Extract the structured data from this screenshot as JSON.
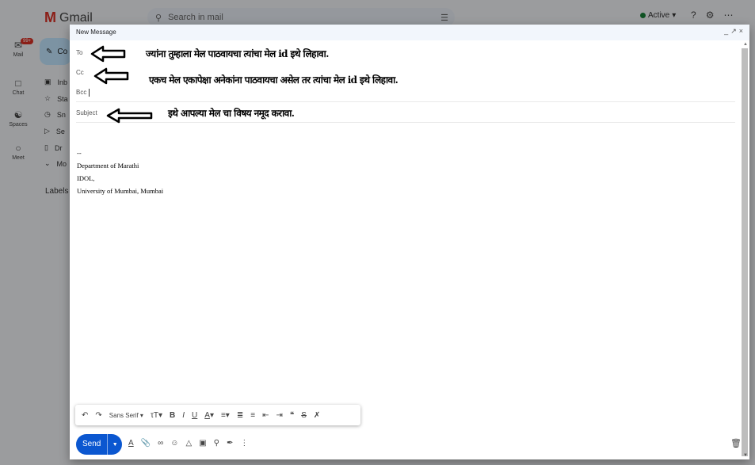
{
  "app": {
    "name": "Gmail"
  },
  "search": {
    "placeholder": "Search in mail"
  },
  "status": {
    "label": "Active"
  },
  "rail": {
    "mail": {
      "label": "Mail",
      "badge": "99+"
    },
    "chat": {
      "label": "Chat"
    },
    "spaces": {
      "label": "Spaces"
    },
    "meet": {
      "label": "Meet"
    }
  },
  "sidebar": {
    "compose_label": "Co",
    "items": [
      {
        "label": "Inb"
      },
      {
        "label": "Sta"
      },
      {
        "label": "Sn"
      },
      {
        "label": "Se"
      },
      {
        "label": "Dr"
      },
      {
        "label": "Mo"
      }
    ],
    "labels_heading": "Labels"
  },
  "compose": {
    "title": "New Message",
    "to_label": "To",
    "cc_label": "Cc",
    "bcc_label": "Bcc",
    "subject_placeholder": "Subject",
    "signature": {
      "dashes": "--",
      "line1": "Department of Marathi",
      "line2": "IDOL,",
      "line3": "University of Mumbai, Mumbai"
    },
    "send_label": "Send",
    "font_label": "Sans Serif"
  },
  "annotations": {
    "to_note": "ज्यांना तुम्हाला मेल पाठवायचा त्यांचा मेल id इथे लिहावा.",
    "cc_note": "एकच मेल एकापेक्षा अनेकांना पाठवायचा असेल तर त्यांचा मेल id इथे लिहावा.",
    "subject_note": "इथे आपल्या मेल चा विषय नमूद करावा."
  },
  "colors": {
    "send": "#0b57d0",
    "compose_header": "#f2f6fc",
    "gmail_red": "#d93025"
  }
}
